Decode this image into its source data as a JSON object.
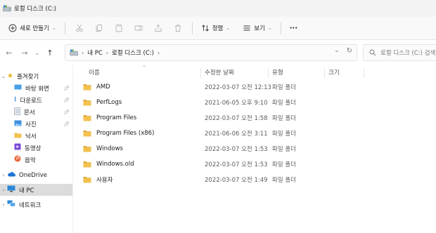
{
  "window": {
    "title": "로컬 디스크 (C:)"
  },
  "toolbar": {
    "new_label": "새로 만들기",
    "sort_label": "정렬",
    "view_label": "보기",
    "more_label": "···"
  },
  "address": {
    "crumbs": [
      "내 PC",
      "로컬 디스크 (C:)"
    ]
  },
  "search": {
    "placeholder": "로컬 디스크 (C:) 검색"
  },
  "sidebar": {
    "quick_access": "즐겨찾기",
    "items": [
      {
        "label": "바탕 화면",
        "icon": "desktop-icon",
        "pinned": true
      },
      {
        "label": "다운로드",
        "icon": "download-icon",
        "pinned": true
      },
      {
        "label": "문서",
        "icon": "document-icon",
        "pinned": true
      },
      {
        "label": "사진",
        "icon": "picture-icon",
        "pinned": true
      },
      {
        "label": "낙서",
        "icon": "folder-icon",
        "pinned": false
      },
      {
        "label": "동영상",
        "icon": "video-icon",
        "pinned": false
      },
      {
        "label": "음악",
        "icon": "music-icon",
        "pinned": false
      }
    ],
    "onedrive": "OneDrive",
    "this_pc": "내 PC",
    "network": "네트워크"
  },
  "columns": {
    "name": "이름",
    "date": "수정한 날짜",
    "type": "유형",
    "size": "크기"
  },
  "files": [
    {
      "name": "AMD",
      "date": "2022-03-07 오전 12:13",
      "type": "파일 폴더"
    },
    {
      "name": "PerfLogs",
      "date": "2021-06-05 오후 9:10",
      "type": "파일 폴더"
    },
    {
      "name": "Program Files",
      "date": "2022-03-07 오전 1:58",
      "type": "파일 폴더"
    },
    {
      "name": "Program Files (x86)",
      "date": "2021-06-06 오전 3:11",
      "type": "파일 폴더"
    },
    {
      "name": "Windows",
      "date": "2022-03-07 오전 1:53",
      "type": "파일 폴더"
    },
    {
      "name": "Windows.old",
      "date": "2022-03-07 오전 1:53",
      "type": "파일 폴더"
    },
    {
      "name": "사용자",
      "date": "2022-03-07 오전 1:49",
      "type": "파일 폴더"
    }
  ],
  "colors": {
    "folder": "#f2c14e",
    "folder_dark": "#dea83a",
    "selected": "#dcdcdc",
    "accent": "#0067c0"
  }
}
